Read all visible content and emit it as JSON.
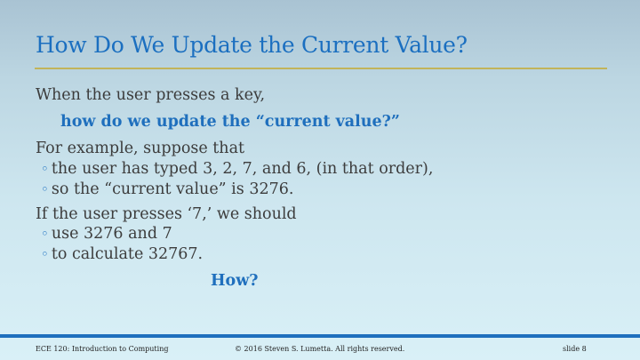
{
  "slide": {
    "title": "How Do We Update the Current Value?",
    "lines": {
      "l1": "When the user presses a key,",
      "l2": "how do we update the “current value?”",
      "l3": "For example, suppose that",
      "l4": "the user has typed 3, 2, 7, and 6, (in that order),",
      "l5": "so the “current value” is 3276.",
      "l6": "If the user presses ‘7,’ we should",
      "l7": "use 3276 and 7",
      "l8": "to calculate 32767.",
      "l9": "How?"
    }
  },
  "footer": {
    "course": "ECE 120: Introduction to Computing",
    "copyright": "© 2016 Steven S. Lumetta.  All rights reserved.",
    "slide_number": "slide 8"
  },
  "colors": {
    "title": "#1b6fc0",
    "emphasis": "#1f6fbd",
    "rule": "#c2b45a",
    "footer_bar": "#1f6fbd"
  }
}
